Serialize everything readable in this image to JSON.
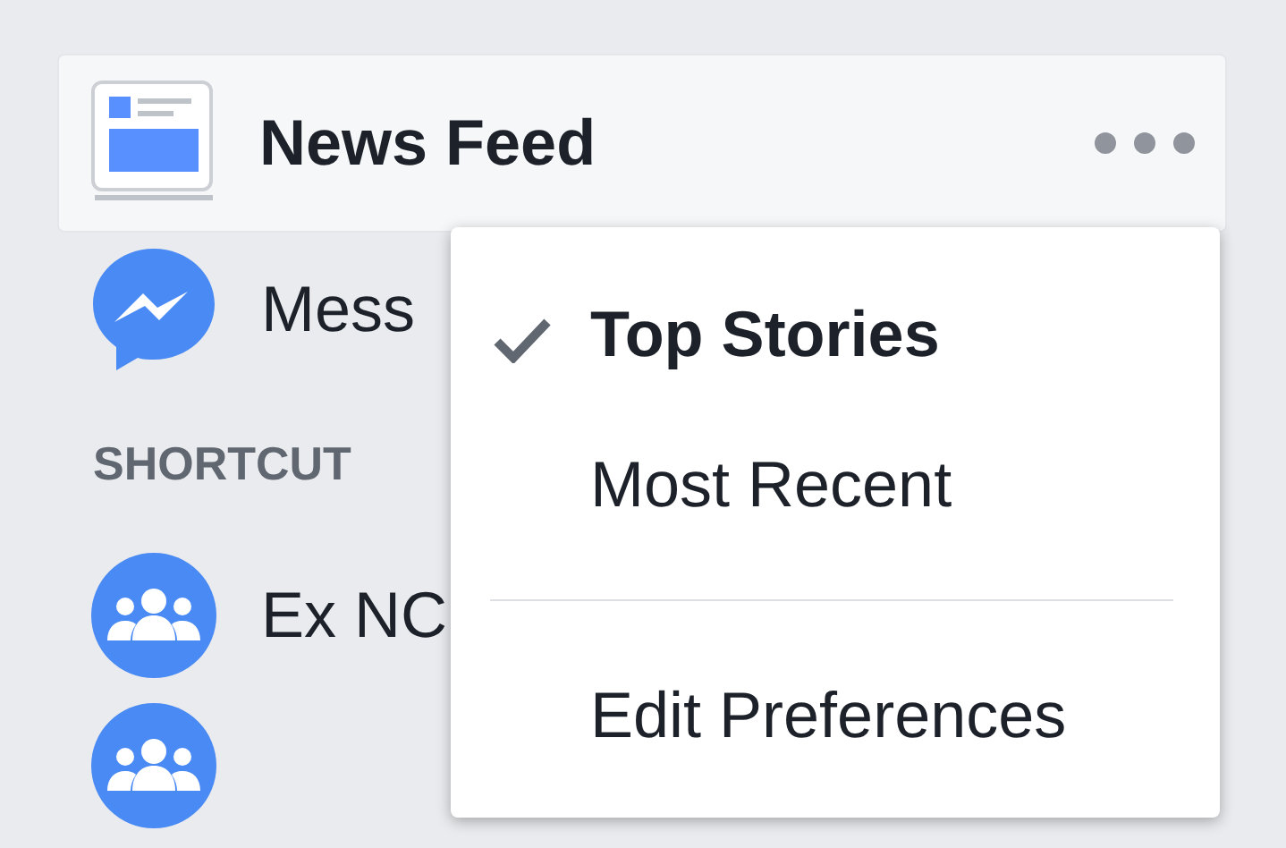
{
  "news_feed": {
    "label": "News Feed",
    "selected": true
  },
  "sidebar_items": [
    {
      "label": "Mess",
      "kind": "messenger"
    }
  ],
  "section_heading": "SHORTCUT",
  "shortcuts": [
    {
      "label": "Ex NC",
      "kind": "group"
    },
    {
      "kind": "group"
    }
  ],
  "menu": {
    "items": [
      {
        "label": "Top Stories",
        "checked": true
      },
      {
        "label": "Most Recent",
        "checked": false
      }
    ],
    "footer_items": [
      {
        "label": "Edit Preferences"
      }
    ]
  }
}
